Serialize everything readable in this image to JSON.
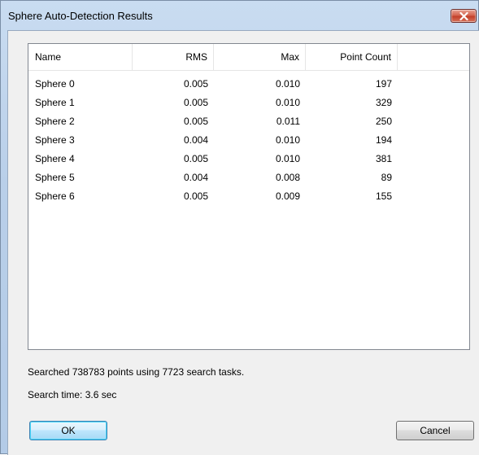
{
  "window": {
    "title": "Sphere Auto-Detection Results"
  },
  "list": {
    "columns": [
      "Name",
      "RMS",
      "Max",
      "Point Count"
    ],
    "rows": [
      [
        "Sphere 0",
        "0.005",
        "0.010",
        "197"
      ],
      [
        "Sphere 1",
        "0.005",
        "0.010",
        "329"
      ],
      [
        "Sphere 2",
        "0.005",
        "0.011",
        "250"
      ],
      [
        "Sphere 3",
        "0.004",
        "0.010",
        "194"
      ],
      [
        "Sphere 4",
        "0.005",
        "0.010",
        "381"
      ],
      [
        "Sphere 5",
        "0.004",
        "0.008",
        "89"
      ],
      [
        "Sphere 6",
        "0.005",
        "0.009",
        "155"
      ]
    ]
  },
  "status": {
    "searched": "Searched 738783 points using 7723 search tasks.",
    "search_time": "Search time: 3.6 sec"
  },
  "buttons": {
    "ok": "OK",
    "cancel": "Cancel"
  },
  "icons": {
    "close": "close-icon"
  }
}
